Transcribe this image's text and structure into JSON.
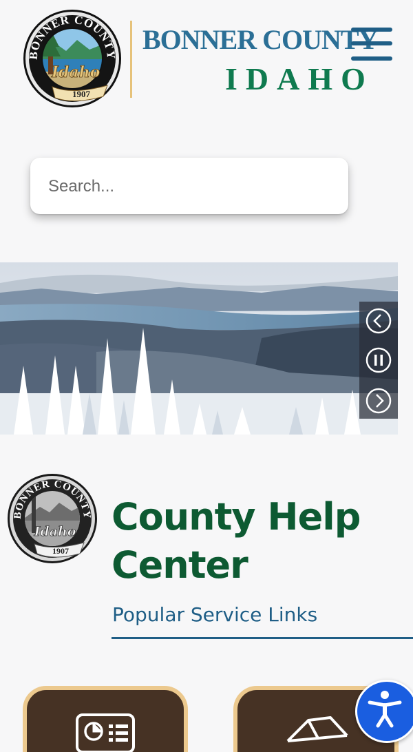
{
  "header": {
    "brand_line1": "BONNER COUNTY",
    "brand_line2": "IDAHO",
    "seal": {
      "ring_text": "BONNER COUNTY",
      "script": "Idaho",
      "year": "1907"
    },
    "menu_icon": "hamburger-menu-icon"
  },
  "search": {
    "placeholder": "Search..."
  },
  "hero": {
    "controls": {
      "prev_icon": "chevron-left-icon",
      "pause_icon": "pause-icon",
      "next_icon": "chevron-right-icon"
    }
  },
  "help": {
    "title": "County Help Center",
    "subtitle": "Popular Service Links",
    "seal": {
      "ring_text": "BONNER COUNTY",
      "script": "Idaho",
      "year": "1907"
    }
  },
  "tiles": [
    {
      "icon": "document-chart-icon"
    },
    {
      "icon": "box-icon"
    }
  ],
  "accessibility": {
    "icon": "accessibility-icon"
  },
  "colors": {
    "brand_blue": "#2b6f96",
    "brand_green": "#0f7a4f",
    "title_green": "#0d5a32",
    "tile_brown": "#463224",
    "tile_border": "#ecc98e",
    "a11y_blue": "#1a5ee0"
  }
}
